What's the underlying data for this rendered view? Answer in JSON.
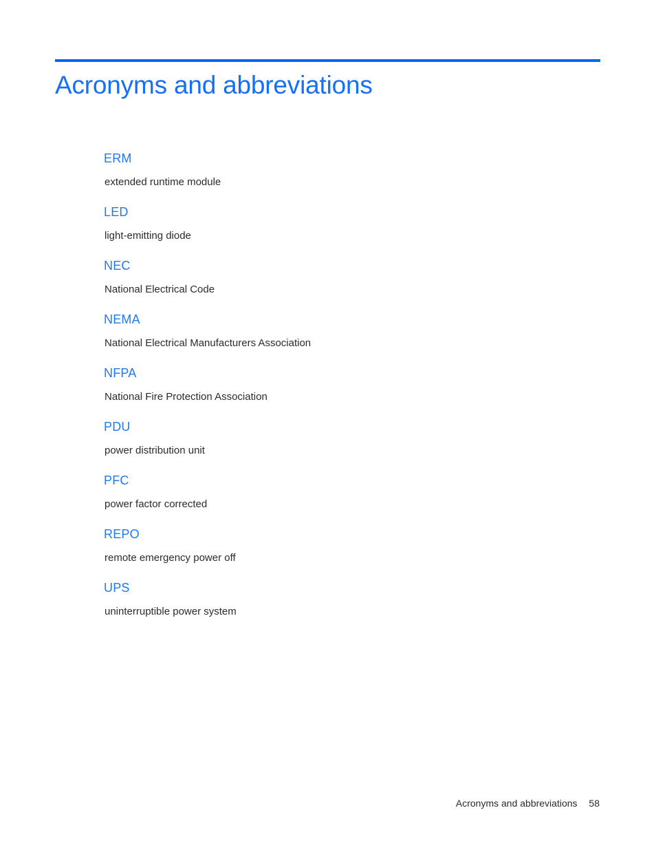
{
  "document": {
    "page_title": "Acronyms and abbreviations",
    "accent_color": "#0066f5",
    "heading_color": "#1471f7",
    "term_color": "#1f79f2",
    "body_color": "#2b2b2b",
    "background_color": "#ffffff"
  },
  "glossary": {
    "entries": [
      {
        "term": "ERM",
        "definition": "extended runtime module"
      },
      {
        "term": "LED",
        "definition": "light-emitting diode"
      },
      {
        "term": "NEC",
        "definition": "National Electrical Code"
      },
      {
        "term": "NEMA",
        "definition": "National Electrical Manufacturers Association"
      },
      {
        "term": "NFPA",
        "definition": "National Fire Protection Association"
      },
      {
        "term": "PDU",
        "definition": "power distribution unit"
      },
      {
        "term": "PFC",
        "definition": "power factor corrected"
      },
      {
        "term": "REPO",
        "definition": "remote emergency power off"
      },
      {
        "term": "UPS",
        "definition": "uninterruptible power system"
      }
    ]
  },
  "footer": {
    "label": "Acronyms and abbreviations",
    "page_number": "58"
  }
}
